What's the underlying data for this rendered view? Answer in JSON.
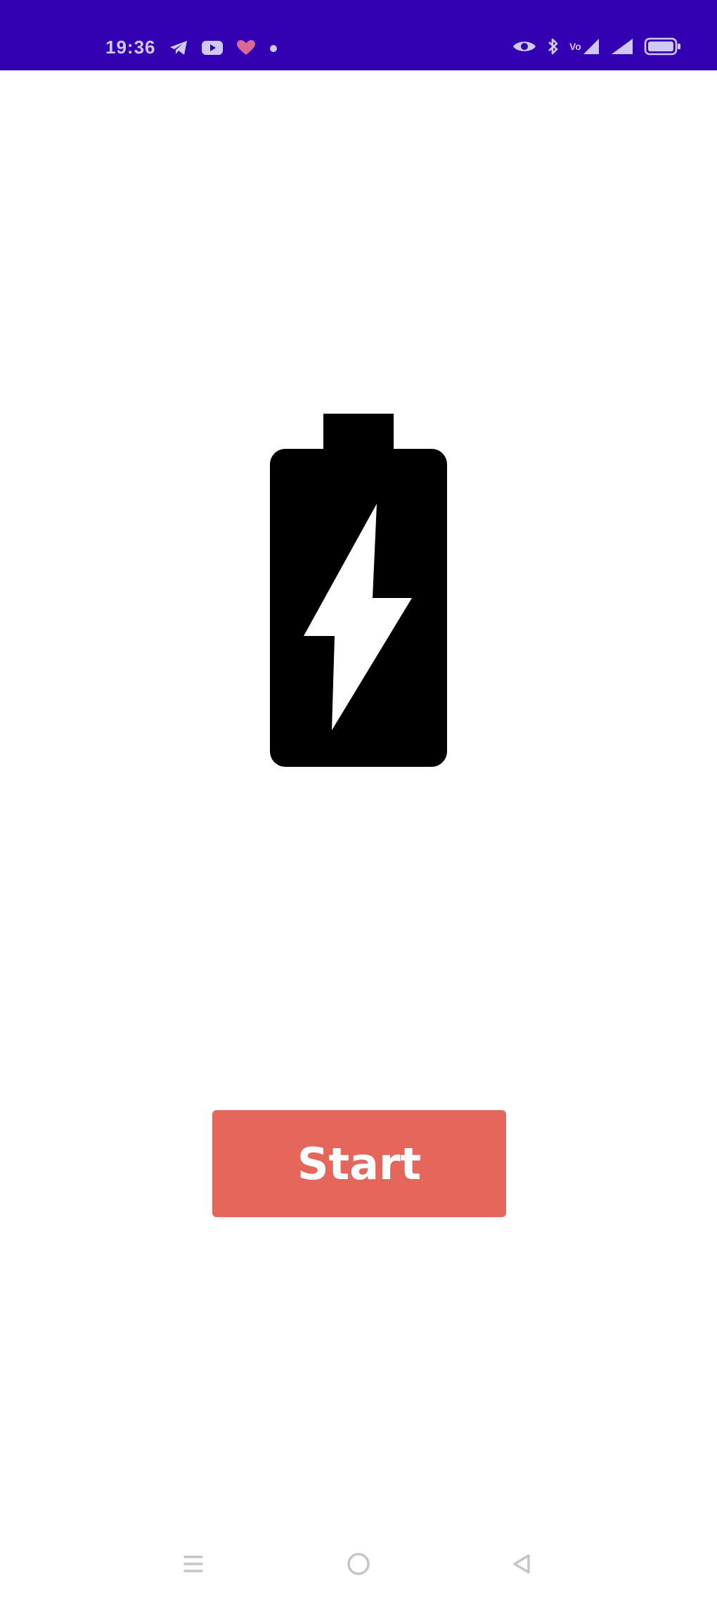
{
  "status_bar": {
    "time": "19:36",
    "background": "#3300b2",
    "left_icons": [
      "telegram-icon",
      "youtube-icon",
      "heart-icon",
      "dot-icon"
    ],
    "right_icons": [
      "eye-icon",
      "bluetooth-icon",
      "signal-1-icon",
      "signal-2-icon",
      "battery-status-icon"
    ]
  },
  "main": {
    "hero_icon": "battery-charging-icon",
    "hero_icon_color": "#000000",
    "start_button": {
      "label": "Start",
      "color": "#e5665a"
    }
  },
  "nav_bar": {
    "buttons": [
      "recent-apps-icon",
      "home-icon",
      "back-icon"
    ]
  }
}
